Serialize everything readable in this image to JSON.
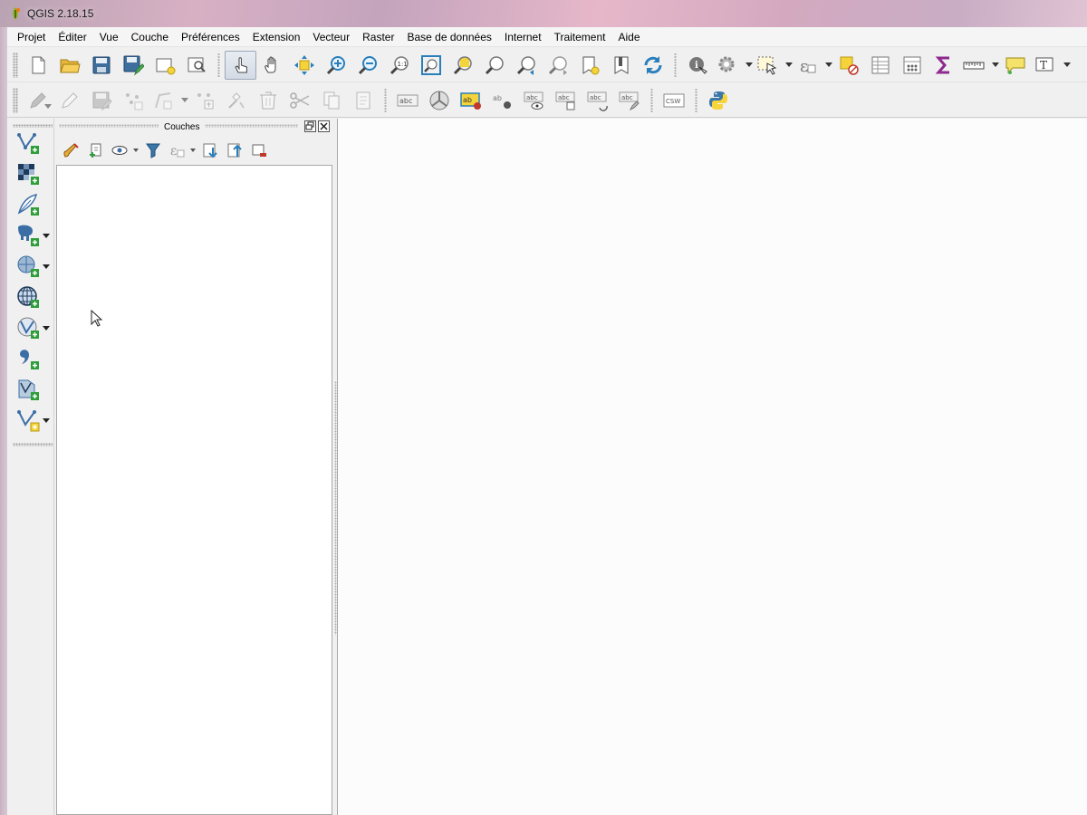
{
  "window": {
    "title": "QGIS 2.18.15"
  },
  "menu": [
    "Projet",
    "Éditer",
    "Vue",
    "Couche",
    "Préférences",
    "Extension",
    "Vecteur",
    "Raster",
    "Base de données",
    "Internet",
    "Traitement",
    "Aide"
  ],
  "toolbar1": [
    "new-project",
    "open-project",
    "save-project",
    "save-as",
    "new-print-composer",
    "composer-manager",
    "touch-zoom-pan",
    "pan-map",
    "pan-to-selection",
    "zoom-in",
    "zoom-out",
    "zoom-native",
    "zoom-full",
    "zoom-to-selection",
    "zoom-to-layer",
    "zoom-last",
    "zoom-next",
    "new-bookmark",
    "show-bookmarks",
    "refresh",
    "identify",
    "action",
    "select-features",
    "select-expression",
    "deselect",
    "attribute-table",
    "field-calculator",
    "statistical-summary",
    "measure",
    "map-tips",
    "text-annotation"
  ],
  "toolbar2": [
    "current-edits",
    "toggle-editing",
    "save-layer-edits",
    "add-feature",
    "vertex-tool",
    "move-feature",
    "node-tool",
    "delete-selected",
    "cut-features",
    "copy-features",
    "paste-features",
    "layer-labeling",
    "diagram",
    "layer-label-options",
    "pin-labels",
    "show-hide-labels",
    "move-label",
    "rotate-label",
    "change-label",
    "csw",
    "python-console"
  ],
  "layers_panel": {
    "title": "Couches"
  },
  "left_toolbar": [
    "add-vector-layer",
    "add-raster-layer",
    "add-delimited-text-layer",
    "add-postgis-layer",
    "add-spatialite-layer",
    "add-wms-layer",
    "add-wfs-layer",
    "add-wcs-layer",
    "add-virtual-layer",
    "new-shapefile-layer"
  ],
  "colors": {
    "accent": "#2a7fbb",
    "plus_green": "#2f9e3a",
    "python_blue": "#3b77a8",
    "python_yellow": "#f7d43a"
  }
}
